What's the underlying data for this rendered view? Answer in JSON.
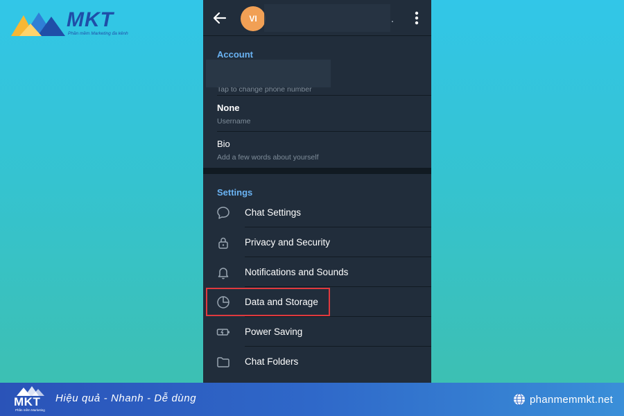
{
  "brand": {
    "name": "MKT",
    "tagline": "Phần mềm Marketing đa kênh"
  },
  "appbar": {
    "avatar_initials": "VI",
    "name_suffix": "."
  },
  "account": {
    "title": "Account",
    "phone_hint": "Tap to change phone number",
    "username_value": "None",
    "username_label": "Username",
    "bio_value": "Bio",
    "bio_hint": "Add a few words about yourself"
  },
  "settings": {
    "title": "Settings",
    "items": [
      {
        "label": "Chat Settings",
        "icon": "chat-bubble-icon"
      },
      {
        "label": "Privacy and Security",
        "icon": "lock-icon"
      },
      {
        "label": "Notifications and Sounds",
        "icon": "bell-icon"
      },
      {
        "label": "Data and Storage",
        "icon": "pie-chart-icon"
      },
      {
        "label": "Power Saving",
        "icon": "battery-icon"
      },
      {
        "label": "Chat Folders",
        "icon": "folder-icon"
      }
    ],
    "highlighted_item": "Data and Storage"
  },
  "footer": {
    "brand": "MKT",
    "brand_tagline": "Phần mềm Marketing",
    "slogan": "Hiệu quả - Nhanh  - Dễ dùng",
    "site": "phanmemmkt.net"
  },
  "colors": {
    "panel_bg": "#1c2733",
    "section_bg": "#212d3b",
    "accent": "#6ab3f3",
    "avatar": "#f1a055",
    "highlight": "#e0393e",
    "brand_blue": "#1f4ea8"
  }
}
